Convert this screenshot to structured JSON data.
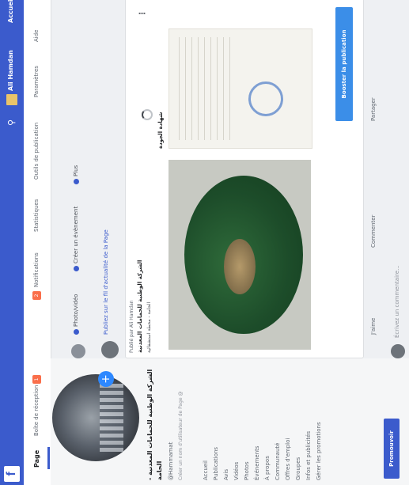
{
  "topbar": {
    "logo": "f",
    "search_placeholder": "",
    "username": "Ali Hamdan",
    "home_label": "Accueil"
  },
  "nav": {
    "title": "Page",
    "tabs": [
      {
        "label": "Boîte de réception",
        "badge": "1"
      },
      {
        "label": "Notifications",
        "badge": "2"
      },
      {
        "label": "Statistiques"
      },
      {
        "label": "Outils de publication"
      },
      {
        "label": "Paramètres"
      },
      {
        "label": "Aide"
      }
    ]
  },
  "profile": {
    "page_name": "الشركة الوطنية للحمامات المعدنية - الحامة",
    "handle": "@Hammamat",
    "info": "Créer un nom d'utilisateur de Page @"
  },
  "side_menu": {
    "items": [
      "Accueil",
      "Publications",
      "Avis",
      "Vidéos",
      "Photos",
      "Événements",
      "À propos",
      "Communauté",
      "Offres d'emploi",
      "Groupes",
      "Infos et publicités",
      "Gérer les promotions"
    ],
    "promote_label": "Promouvoir"
  },
  "feed": {
    "actions": [
      {
        "label": "Photo/vidéo"
      },
      {
        "label": "Créer un évènement"
      },
      {
        "label": "Plus"
      }
    ],
    "promo_text": "Publiez sur le fil d'actualité de la Page",
    "post": {
      "header": "Publié par Ali Hamdan",
      "author": "الشركة الوطنية للحمامات المعدنية",
      "text": "الحامة - محطة استشفائية",
      "caption": "شهادة الجودة"
    },
    "boost_label": "Booster la publication",
    "bar": [
      {
        "label": "J'aime"
      },
      {
        "label": "Commenter"
      },
      {
        "label": "Partager"
      }
    ],
    "comment_placeholder": "Écrivez un commentaire..."
  }
}
